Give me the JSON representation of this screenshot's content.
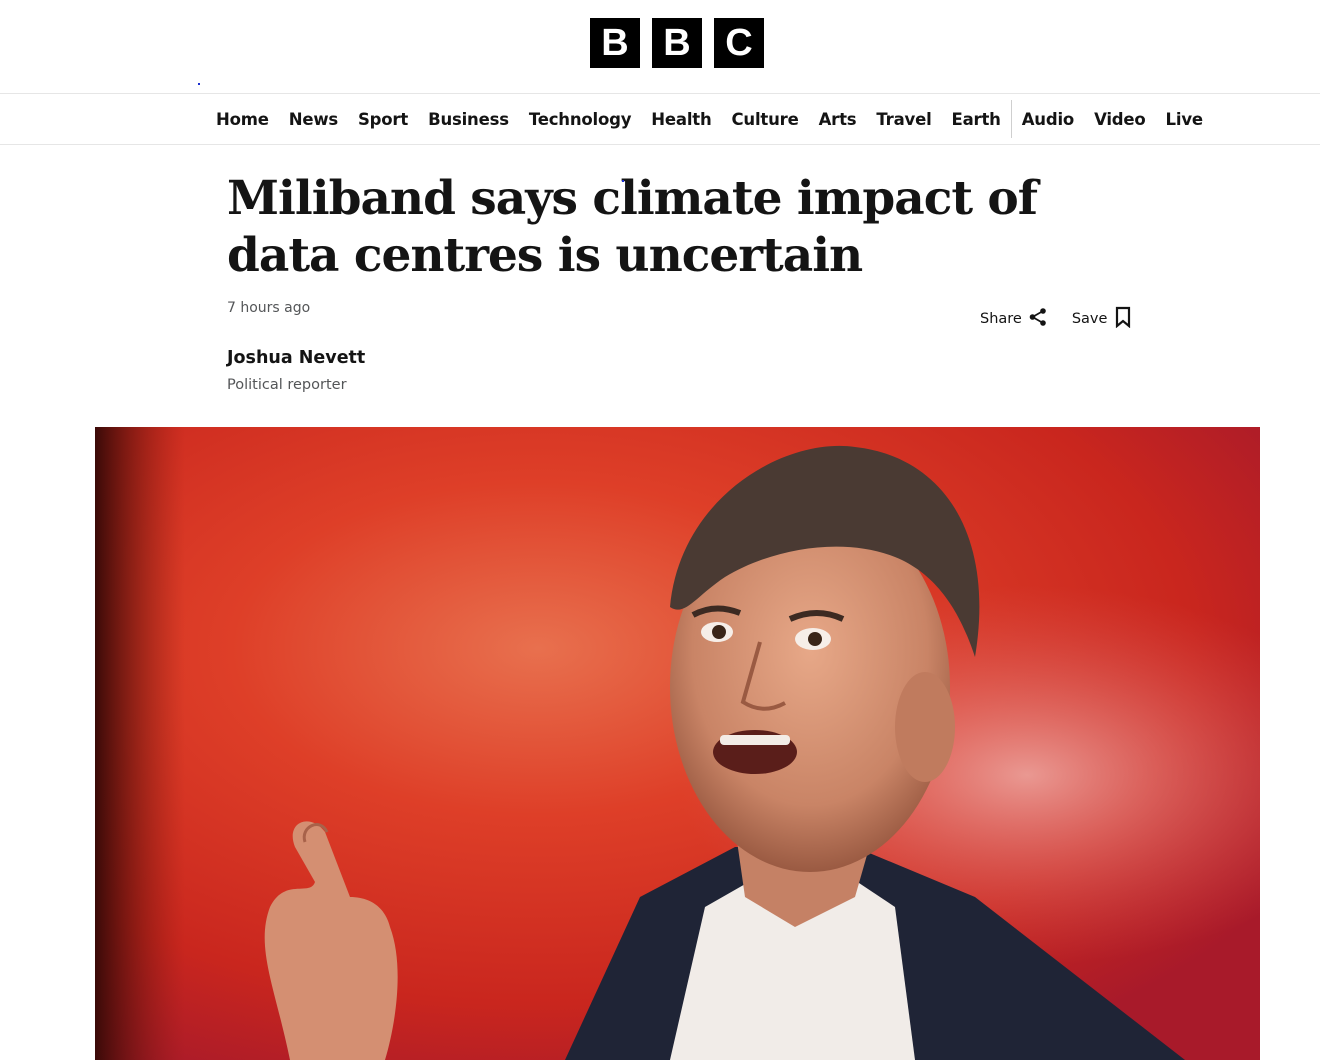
{
  "header": {
    "logo_letters": [
      "B",
      "B",
      "C"
    ]
  },
  "nav": {
    "items": [
      "Home",
      "News",
      "Sport",
      "Business",
      "Technology",
      "Health",
      "Culture",
      "Arts",
      "Travel",
      "Earth"
    ],
    "secondary": [
      "Audio",
      "Video",
      "Live"
    ]
  },
  "article": {
    "headline": "Miliband says climate impact of data centres is uncertain",
    "timestamp": "7 hours ago",
    "author": "Joshua Nevett",
    "author_role": "Political reporter"
  },
  "actions": {
    "share_label": "Share",
    "save_label": "Save"
  },
  "icons": {
    "share": "share-icon",
    "save": "bookmark-icon"
  },
  "colors": {
    "accent": "#000000",
    "background": "#ffffff",
    "image_red": "#d42a1e"
  }
}
